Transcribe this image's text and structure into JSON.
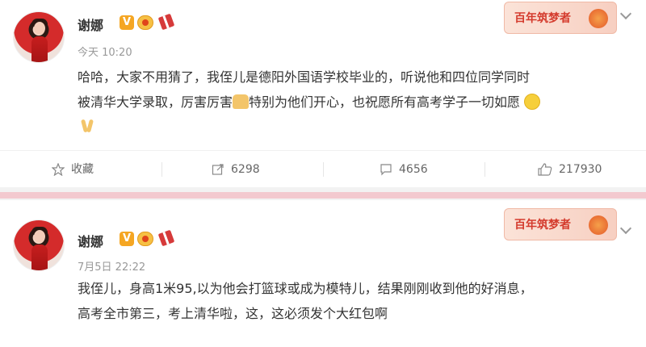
{
  "posts": [
    {
      "author": "谢娜",
      "verified": "V",
      "time": "今天 10:20",
      "stamp": "百年筑梦者",
      "lines": [
        "哈哈，大家不用猜了，我侄儿是德阳外国语学校毕业的，听说他和四位同学同时",
        "被清华大学录取，厉害厉害",
        "特别为他们开心，也祝愿所有高考学子一切如愿"
      ],
      "actions": {
        "favorite_label": "收藏",
        "repost_count": "6298",
        "comment_count": "4656",
        "like_count": "217930"
      }
    },
    {
      "author": "谢娜",
      "verified": "V",
      "time": "7月5日 22:22",
      "stamp": "百年筑梦者",
      "lines": [
        "我侄儿，身高1米95,以为他会打篮球或成为模特儿，结果刚刚收到他的好消息，",
        "高考全市第三，考上清华啦，这，这必须发个大红包啊"
      ]
    }
  ],
  "colors": {
    "accent": "#f5a623",
    "divider_pink": "#f3c9cf",
    "stamp_red": "#d43b2d"
  }
}
